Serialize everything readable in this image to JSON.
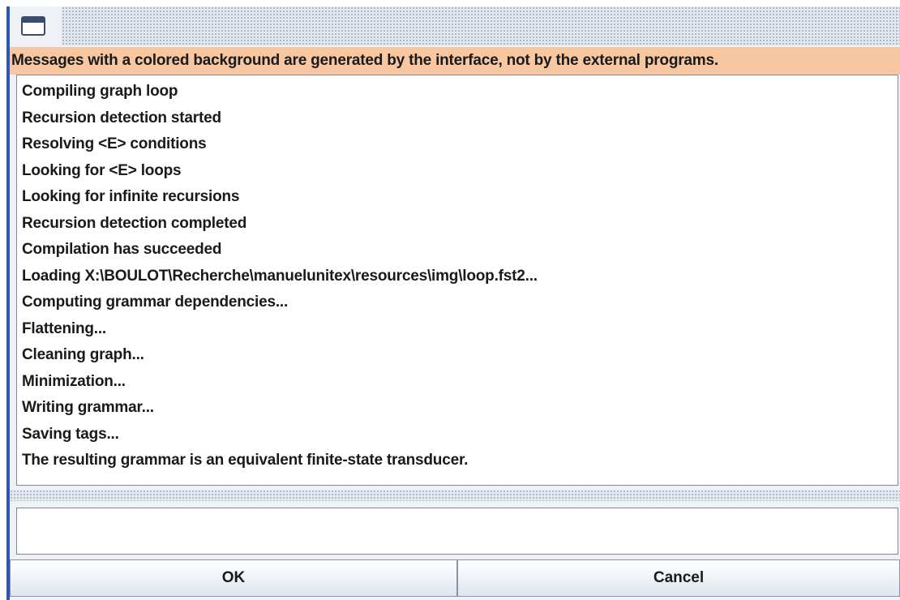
{
  "window": {
    "icon": "window-icon"
  },
  "notice": {
    "text": "Messages with a colored background are generated by the interface, not by the external programs.",
    "background_color": "#f7c7a2"
  },
  "log": {
    "lines": [
      "Compiling graph loop",
      "Recursion detection started",
      "Resolving <E> conditions",
      "Looking for <E> loops",
      "Looking for infinite recursions",
      "Recursion detection completed",
      "Compilation has succeeded",
      "Loading X:\\BOULOT\\Recherche\\manuelunitex\\resources\\img\\loop.fst2...",
      "Computing grammar dependencies...",
      "Flattening...",
      "Cleaning graph...",
      "Minimization...",
      "Writing grammar...",
      "Saving tags...",
      "The resulting grammar is an equivalent finite-state transducer."
    ]
  },
  "input": {
    "value": ""
  },
  "buttons": {
    "ok_label": "OK",
    "cancel_label": "Cancel"
  }
}
